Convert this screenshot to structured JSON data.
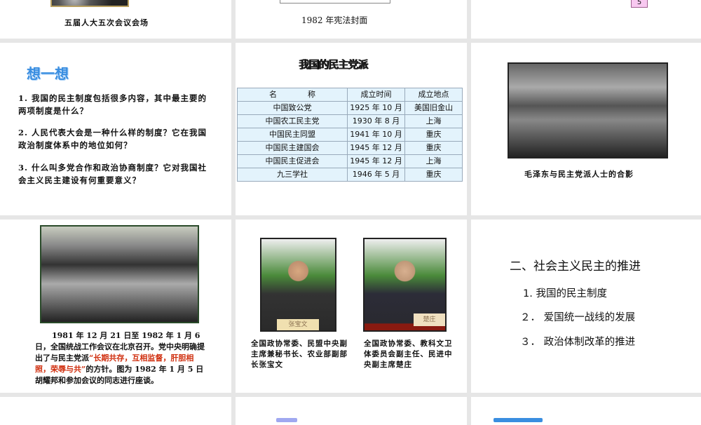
{
  "slides": {
    "s1": {
      "caption": "五届人大五次会议会场"
    },
    "s2": {
      "caption": "1982 年宪法封面"
    },
    "s3": {
      "badge": "5"
    },
    "s4": {
      "title": "想一想",
      "questions": [
        "1.  我国的民主制度包括很多内容，其中最主要的两项制度是什么？",
        "2.  人民代表大会是一种什么样的制度？它在我国政治制度体系中的地位如何？",
        "3.  什么叫多党合作和政治协商制度？它对我国社会主义民主建设有何重要意义？"
      ]
    },
    "s5": {
      "title": "我国的民主党派",
      "headers": [
        "名　　　　称",
        "成立时间",
        "成立地点"
      ],
      "rows": [
        [
          "中国致公党",
          "1925 年 10 月",
          "美国旧金山"
        ],
        [
          "中国农工民主党",
          "1930 年 8 月",
          "上海"
        ],
        [
          "中国民主同盟",
          "1941 年 10 月",
          "重庆"
        ],
        [
          "中国民主建国会",
          "1945 年 12 月",
          "重庆"
        ],
        [
          "中国民主促进会",
          "1945 年 12 月",
          "上海"
        ],
        [
          "九三学社",
          "1946 年 5 月",
          "重庆"
        ]
      ]
    },
    "s6": {
      "caption": "毛泽东与民主党派人士的合影"
    },
    "s7": {
      "text_a": "1981 年 12 月 21 日至 1982 年 1 月 6 日，全国统战工作会议在北京召开。党中央明确提出了与民主党派",
      "text_red": "“长期共存，互相监督，肝胆相照，荣辱与共”",
      "text_b": "的方针。图为 1982 年 1 月 5 日胡耀邦和参加会议的同志进行座谈。"
    },
    "s8": {
      "nameplate_1": "张宝文",
      "nameplate_2": "楚庄",
      "caption_1": "全国政协常委、民盟中央副主席兼秘书长、农业部副部长张宝文",
      "caption_2": "全国政协常委、教科文卫体委员会副主任、民进中央副主席楚庄"
    },
    "s9": {
      "heading": "二、社会主义民主的推进",
      "items": [
        "1.  我国的民主制度",
        "２．  爱国统一战线的发展",
        "３．  政治体制改革的推进"
      ]
    }
  },
  "colors": {
    "accent_blue": "#3a8ee0",
    "red_text": "#d03010",
    "table_bg": "#e3f3fc"
  }
}
